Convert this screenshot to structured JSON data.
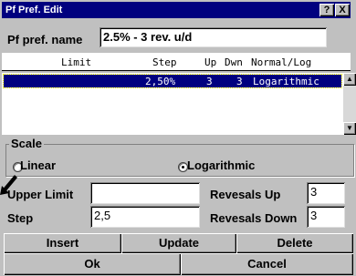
{
  "window": {
    "title": "Pf Pref. Edit",
    "help_label": "?",
    "close_label": "X"
  },
  "name": {
    "label": "Pf pref. name",
    "value": "2.5% - 3 rev. u/d"
  },
  "list": {
    "columns": [
      "Limit",
      "Step",
      "Up",
      "Dwn",
      "Normal/Log"
    ],
    "rows": [
      {
        "limit": "",
        "step": "2,50%",
        "up": "3",
        "dwn": "3",
        "mode": "Logarithmic"
      }
    ],
    "scroll_up": "▲",
    "scroll_down": "▼"
  },
  "scale": {
    "label": "Scale",
    "options": [
      "Linear",
      "Logarithmic"
    ],
    "selected": "Logarithmic"
  },
  "fields": {
    "upper_limit_label": "Upper Limit",
    "upper_limit_value": "",
    "step_label": "Step",
    "step_value": "2,5",
    "reversals_up_label": "Revesals Up",
    "reversals_up_value": "3",
    "reversals_down_label": "Revesals Down",
    "reversals_down_value": "3"
  },
  "buttons": {
    "insert": "Insert",
    "update": "Update",
    "delete": "Delete",
    "ok": "Ok",
    "cancel": "Cancel"
  },
  "colors": {
    "titlebar": "#00007f",
    "face": "#c0c0c0",
    "selection": "#00007f"
  }
}
